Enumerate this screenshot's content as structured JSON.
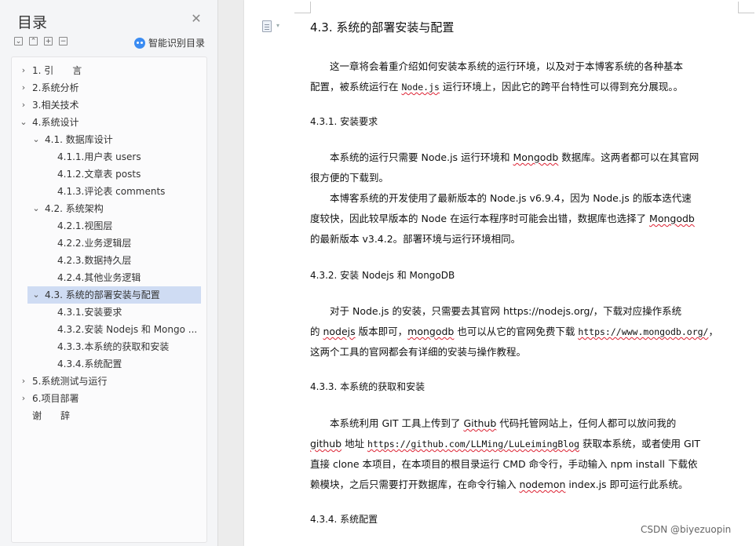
{
  "sidebar": {
    "title": "目录",
    "ai_label": "智能识别目录",
    "items": [
      {
        "label": "1. 引　　言",
        "chev": "›",
        "level": 1
      },
      {
        "label": "2.系统分析",
        "chev": "›",
        "level": 1
      },
      {
        "label": "3.相关技术",
        "chev": "›",
        "level": 1
      },
      {
        "label": "4.系统设计",
        "chev": "⌄",
        "level": 1
      },
      {
        "label": "4.1.  数据库设计",
        "chev": "⌄",
        "level": 2
      },
      {
        "label": "4.1.1.用户表 users",
        "chev": "",
        "level": 3
      },
      {
        "label": "4.1.2.文章表 posts",
        "chev": "",
        "level": 3
      },
      {
        "label": "4.1.3.评论表 comments",
        "chev": "",
        "level": 3
      },
      {
        "label": "4.2.  系统架构",
        "chev": "⌄",
        "level": 2
      },
      {
        "label": "4.2.1.视图层",
        "chev": "",
        "level": 3
      },
      {
        "label": "4.2.2.业务逻辑层",
        "chev": "",
        "level": 3
      },
      {
        "label": "4.2.3.数据持久层",
        "chev": "",
        "level": 3
      },
      {
        "label": "4.2.4.其他业务逻辑",
        "chev": "",
        "level": 3
      },
      {
        "label": "4.3.  系统的部署安装与配置",
        "chev": "⌄",
        "level": 2,
        "selected": true
      },
      {
        "label": "4.3.1.安装要求",
        "chev": "",
        "level": 3
      },
      {
        "label": "4.3.2.安装 Nodejs 和 Mongo ...",
        "chev": "",
        "level": 3
      },
      {
        "label": "4.3.3.本系统的获取和安装",
        "chev": "",
        "level": 3
      },
      {
        "label": "4.3.4.系统配置",
        "chev": "",
        "level": 3
      },
      {
        "label": "5.系统测试与运行",
        "chev": "›",
        "level": 1
      },
      {
        "label": "6.项目部署",
        "chev": "›",
        "level": 1
      },
      {
        "label": "谢　　辞",
        "chev": "",
        "level": 1
      }
    ]
  },
  "doc": {
    "section_title": "4.3.  系统的部署安装与配置",
    "intro_p1": "这一章将会着重介绍如何安装本系统的运行环境，以及对于本博客系统的各种基本",
    "intro_p2": "配置，被系统运行在 ",
    "intro_p2b": "Node.js",
    "intro_p2c": " 运行环境上，因此它的跨平台特性可以得到充分展现。。",
    "s1_title": "4.3.1.  安装要求",
    "s1_a1": "本系统的运行只需要 Node.js 运行环境和 ",
    "s1_a1b": "Mongodb",
    "s1_a1c": " 数据库。这两者都可以在其官网",
    "s1_a2": "很方便的下载到。",
    "s1_b1": "本博客系统的开发使用了最新版本的 Node.js v6.9.4，因为 Node.js 的版本迭代速",
    "s1_b2": "度较快，因此较早版本的 Node 在运行本程序时可能会出错，数据库也选择了 ",
    "s1_b2b": "Mongodb",
    "s1_b3": "的最新版本 v3.4.2。部署环境与运行环境相同。",
    "s2_title": "4.3.2.  安装 Nodejs 和 MongoDB",
    "s2_a1": "对于 Node.js 的安装，只需要去其官网 https://nodejs.org/，下载对应操作系统",
    "s2_a2a": "的 ",
    "s2_a2b": "nodejs",
    "s2_a2c": " 版本即可，",
    "s2_a2d": "mongodb",
    "s2_a2e": " 也可以从它的官网免费下载 ",
    "s2_a2f": "https://www.mongodb.org/",
    "s2_a2g": "，",
    "s2_a3": "这两个工具的官网都会有详细的安装与操作教程。",
    "s3_title": "4.3.3.  本系统的获取和安装",
    "s3_a1a": "本系统利用 GIT 工具上传到了 ",
    "s3_a1b": "Github",
    "s3_a1c": " 代码托管网站上，任何人都可以放问我的",
    "s3_a2a": "github",
    "s3_a2b": " 地址 ",
    "s3_a2c": "https://github.com/LLMing/LuLeimingBlog",
    "s3_a2d": " 获取本系统，或者使用 GIT",
    "s3_a3": "直接 clone 本项目，在本项目的根目录运行 CMD 命令行，手动输入 npm install 下载依",
    "s3_a4a": "赖模块，之后只需要打开数据库，在命令行输入 ",
    "s3_a4b": "nodemon",
    "s3_a4c": " index.js 即可运行此系统。",
    "s4_title": "4.3.4.  系统配置"
  },
  "watermark": "CSDN @biyezuopin"
}
